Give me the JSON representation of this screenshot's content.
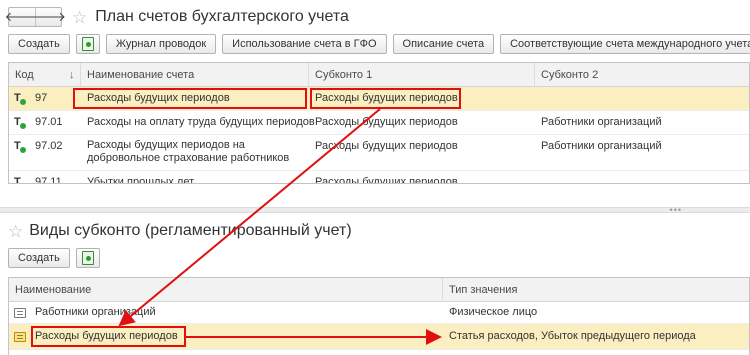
{
  "top": {
    "nav": {
      "back": "🡐",
      "forward": "🡒"
    },
    "star": "☆",
    "title": "План счетов бухгалтерского учета",
    "toolbar": {
      "create": "Создать",
      "journal": "Журнал проводок",
      "usage": "Использование счета в ГФО",
      "description": "Описание счета",
      "intl": "Соответствующие счета международного учета"
    },
    "columns": {
      "code": "Код",
      "sort": "↓",
      "name": "Наименование счета",
      "subconto1": "Субконто 1",
      "subconto2": "Субконто 2"
    },
    "rows": [
      {
        "code": "97",
        "name": "Расходы будущих периодов",
        "sub1": "Расходы будущих периодов",
        "sub2": ""
      },
      {
        "code": "97.01",
        "name": "Расходы на оплату труда будущих периодов",
        "sub1": "Расходы будущих периодов",
        "sub2": "Работники организаций"
      },
      {
        "code": "97.02",
        "name": "Расходы будущих периодов на",
        "name2": "добровольное страхование работников",
        "sub1": "Расходы будущих периодов",
        "sub2": "Работники организаций"
      },
      {
        "code": "97.11",
        "name": "Убытки прошлых лет",
        "sub1": "Расходы будущих периодов",
        "sub2": ""
      }
    ]
  },
  "bottom": {
    "star": "☆",
    "title": "Виды субконто (регламентированный учет)",
    "toolbar": {
      "create": "Создать"
    },
    "columns": {
      "name": "Наименование",
      "type": "Тип значения"
    },
    "rows": [
      {
        "name": "Работники организаций",
        "type": "Физическое лицо"
      },
      {
        "name": "Расходы будущих периодов",
        "type": "Статья расходов, Убыток предыдущего периода"
      }
    ]
  },
  "colors": {
    "highlight": "#e01010",
    "selection": "#fbeec0"
  }
}
